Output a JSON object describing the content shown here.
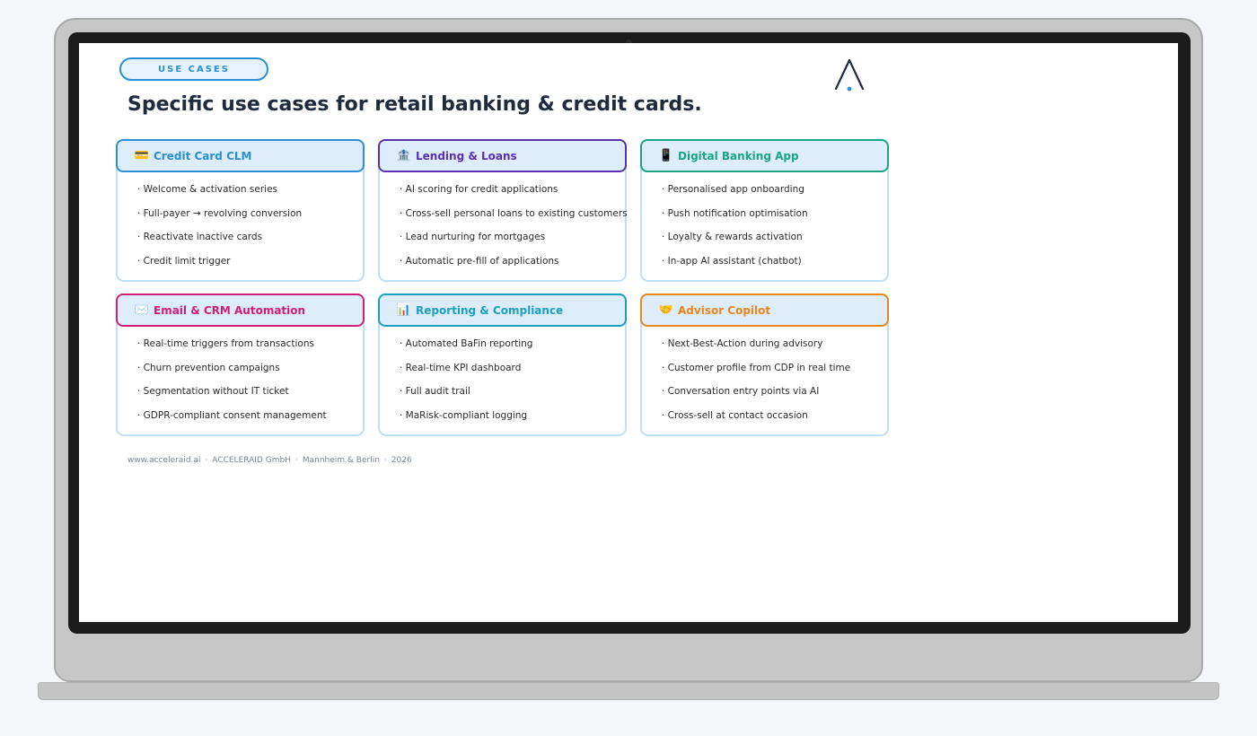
{
  "slide": {
    "section_label": "USE CASES",
    "title": "Specific use cases for retail banking & credit cards.",
    "accent_color": "#2a8fd4"
  },
  "cards": [
    {
      "title": "Credit Card CLM",
      "icon": "credit-card-icon",
      "color": "#2a8fd4",
      "items": [
        "· Welcome & activation series",
        "· Full-payer → revolving conversion",
        "· Reactivate inactive cards",
        "· Credit limit trigger"
      ]
    },
    {
      "title": "Lending & Loans",
      "icon": "bank-icon",
      "color": "#5a2fb3",
      "items": [
        "· AI scoring for credit applications",
        "· Cross-sell personal loans to existing customers",
        "· Lead nurturing for mortgages",
        "· Automatic pre-fill of applications"
      ]
    },
    {
      "title": "Digital Banking App",
      "icon": "mobile-phone-icon",
      "color": "#18a585",
      "items": [
        "· Personalised app onboarding",
        "· Push notification optimisation",
        "· Loyalty & rewards activation",
        "· In-app AI assistant (chatbot)"
      ]
    },
    {
      "title": "Email & CRM Automation",
      "icon": "envelope-icon",
      "color": "#cf1e78",
      "items": [
        "· Real-time triggers from transactions",
        "· Churn prevention campaigns",
        "· Segmentation without IT ticket",
        "· GDPR-compliant consent management"
      ]
    },
    {
      "title": "Reporting & Compliance",
      "icon": "bar-chart-icon",
      "color": "#1d9fc2",
      "items": [
        "· Automated BaFin reporting",
        "· Real-time KPI dashboard",
        "· Full audit trail",
        "· MaRisk-compliant logging"
      ]
    },
    {
      "title": "Advisor Copilot",
      "icon": "handshake-icon",
      "color": "#e9861d",
      "items": [
        "· Next-Best-Action during advisory",
        "· Customer profile from CDP in real time",
        "· Conversation entry points via AI",
        "· Cross-sell at contact occasion"
      ]
    }
  ],
  "footer": {
    "url": "www.acceleraid.ai",
    "company": "ACCELERAID GmbH",
    "locations": "Mannheim & Berlin",
    "year": "2026",
    "separator": "·"
  }
}
